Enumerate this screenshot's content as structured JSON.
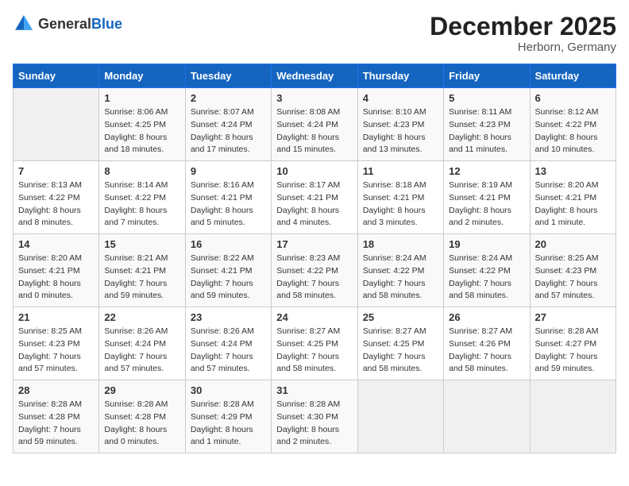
{
  "header": {
    "logo_general": "General",
    "logo_blue": "Blue",
    "month_title": "December 2025",
    "location": "Herborn, Germany"
  },
  "days_of_week": [
    "Sunday",
    "Monday",
    "Tuesday",
    "Wednesday",
    "Thursday",
    "Friday",
    "Saturday"
  ],
  "weeks": [
    [
      {
        "day": "",
        "empty": true
      },
      {
        "day": "1",
        "sunrise": "Sunrise: 8:06 AM",
        "sunset": "Sunset: 4:25 PM",
        "daylight": "Daylight: 8 hours and 18 minutes."
      },
      {
        "day": "2",
        "sunrise": "Sunrise: 8:07 AM",
        "sunset": "Sunset: 4:24 PM",
        "daylight": "Daylight: 8 hours and 17 minutes."
      },
      {
        "day": "3",
        "sunrise": "Sunrise: 8:08 AM",
        "sunset": "Sunset: 4:24 PM",
        "daylight": "Daylight: 8 hours and 15 minutes."
      },
      {
        "day": "4",
        "sunrise": "Sunrise: 8:10 AM",
        "sunset": "Sunset: 4:23 PM",
        "daylight": "Daylight: 8 hours and 13 minutes."
      },
      {
        "day": "5",
        "sunrise": "Sunrise: 8:11 AM",
        "sunset": "Sunset: 4:23 PM",
        "daylight": "Daylight: 8 hours and 11 minutes."
      },
      {
        "day": "6",
        "sunrise": "Sunrise: 8:12 AM",
        "sunset": "Sunset: 4:22 PM",
        "daylight": "Daylight: 8 hours and 10 minutes."
      }
    ],
    [
      {
        "day": "7",
        "sunrise": "Sunrise: 8:13 AM",
        "sunset": "Sunset: 4:22 PM",
        "daylight": "Daylight: 8 hours and 8 minutes."
      },
      {
        "day": "8",
        "sunrise": "Sunrise: 8:14 AM",
        "sunset": "Sunset: 4:22 PM",
        "daylight": "Daylight: 8 hours and 7 minutes."
      },
      {
        "day": "9",
        "sunrise": "Sunrise: 8:16 AM",
        "sunset": "Sunset: 4:21 PM",
        "daylight": "Daylight: 8 hours and 5 minutes."
      },
      {
        "day": "10",
        "sunrise": "Sunrise: 8:17 AM",
        "sunset": "Sunset: 4:21 PM",
        "daylight": "Daylight: 8 hours and 4 minutes."
      },
      {
        "day": "11",
        "sunrise": "Sunrise: 8:18 AM",
        "sunset": "Sunset: 4:21 PM",
        "daylight": "Daylight: 8 hours and 3 minutes."
      },
      {
        "day": "12",
        "sunrise": "Sunrise: 8:19 AM",
        "sunset": "Sunset: 4:21 PM",
        "daylight": "Daylight: 8 hours and 2 minutes."
      },
      {
        "day": "13",
        "sunrise": "Sunrise: 8:20 AM",
        "sunset": "Sunset: 4:21 PM",
        "daylight": "Daylight: 8 hours and 1 minute."
      }
    ],
    [
      {
        "day": "14",
        "sunrise": "Sunrise: 8:20 AM",
        "sunset": "Sunset: 4:21 PM",
        "daylight": "Daylight: 8 hours and 0 minutes."
      },
      {
        "day": "15",
        "sunrise": "Sunrise: 8:21 AM",
        "sunset": "Sunset: 4:21 PM",
        "daylight": "Daylight: 7 hours and 59 minutes."
      },
      {
        "day": "16",
        "sunrise": "Sunrise: 8:22 AM",
        "sunset": "Sunset: 4:21 PM",
        "daylight": "Daylight: 7 hours and 59 minutes."
      },
      {
        "day": "17",
        "sunrise": "Sunrise: 8:23 AM",
        "sunset": "Sunset: 4:22 PM",
        "daylight": "Daylight: 7 hours and 58 minutes."
      },
      {
        "day": "18",
        "sunrise": "Sunrise: 8:24 AM",
        "sunset": "Sunset: 4:22 PM",
        "daylight": "Daylight: 7 hours and 58 minutes."
      },
      {
        "day": "19",
        "sunrise": "Sunrise: 8:24 AM",
        "sunset": "Sunset: 4:22 PM",
        "daylight": "Daylight: 7 hours and 58 minutes."
      },
      {
        "day": "20",
        "sunrise": "Sunrise: 8:25 AM",
        "sunset": "Sunset: 4:23 PM",
        "daylight": "Daylight: 7 hours and 57 minutes."
      }
    ],
    [
      {
        "day": "21",
        "sunrise": "Sunrise: 8:25 AM",
        "sunset": "Sunset: 4:23 PM",
        "daylight": "Daylight: 7 hours and 57 minutes."
      },
      {
        "day": "22",
        "sunrise": "Sunrise: 8:26 AM",
        "sunset": "Sunset: 4:24 PM",
        "daylight": "Daylight: 7 hours and 57 minutes."
      },
      {
        "day": "23",
        "sunrise": "Sunrise: 8:26 AM",
        "sunset": "Sunset: 4:24 PM",
        "daylight": "Daylight: 7 hours and 57 minutes."
      },
      {
        "day": "24",
        "sunrise": "Sunrise: 8:27 AM",
        "sunset": "Sunset: 4:25 PM",
        "daylight": "Daylight: 7 hours and 58 minutes."
      },
      {
        "day": "25",
        "sunrise": "Sunrise: 8:27 AM",
        "sunset": "Sunset: 4:25 PM",
        "daylight": "Daylight: 7 hours and 58 minutes."
      },
      {
        "day": "26",
        "sunrise": "Sunrise: 8:27 AM",
        "sunset": "Sunset: 4:26 PM",
        "daylight": "Daylight: 7 hours and 58 minutes."
      },
      {
        "day": "27",
        "sunrise": "Sunrise: 8:28 AM",
        "sunset": "Sunset: 4:27 PM",
        "daylight": "Daylight: 7 hours and 59 minutes."
      }
    ],
    [
      {
        "day": "28",
        "sunrise": "Sunrise: 8:28 AM",
        "sunset": "Sunset: 4:28 PM",
        "daylight": "Daylight: 7 hours and 59 minutes."
      },
      {
        "day": "29",
        "sunrise": "Sunrise: 8:28 AM",
        "sunset": "Sunset: 4:28 PM",
        "daylight": "Daylight: 8 hours and 0 minutes."
      },
      {
        "day": "30",
        "sunrise": "Sunrise: 8:28 AM",
        "sunset": "Sunset: 4:29 PM",
        "daylight": "Daylight: 8 hours and 1 minute."
      },
      {
        "day": "31",
        "sunrise": "Sunrise: 8:28 AM",
        "sunset": "Sunset: 4:30 PM",
        "daylight": "Daylight: 8 hours and 2 minutes."
      },
      {
        "day": "",
        "empty": true
      },
      {
        "day": "",
        "empty": true
      },
      {
        "day": "",
        "empty": true
      }
    ]
  ]
}
